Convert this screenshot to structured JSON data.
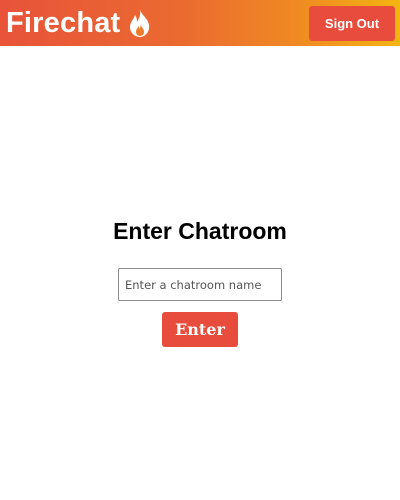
{
  "header": {
    "brand": "Firechat",
    "brand_icon": "flame-icon",
    "signout_label": "Sign Out"
  },
  "main": {
    "title": "Enter Chatroom",
    "input_value": "",
    "input_placeholder": "Enter a chatroom name",
    "enter_label": "Enter"
  },
  "colors": {
    "header_gradient_start": "#e8533a",
    "header_gradient_end": "#f3b511",
    "button_bg": "#e84c3d",
    "button_text": "#ffffff"
  }
}
